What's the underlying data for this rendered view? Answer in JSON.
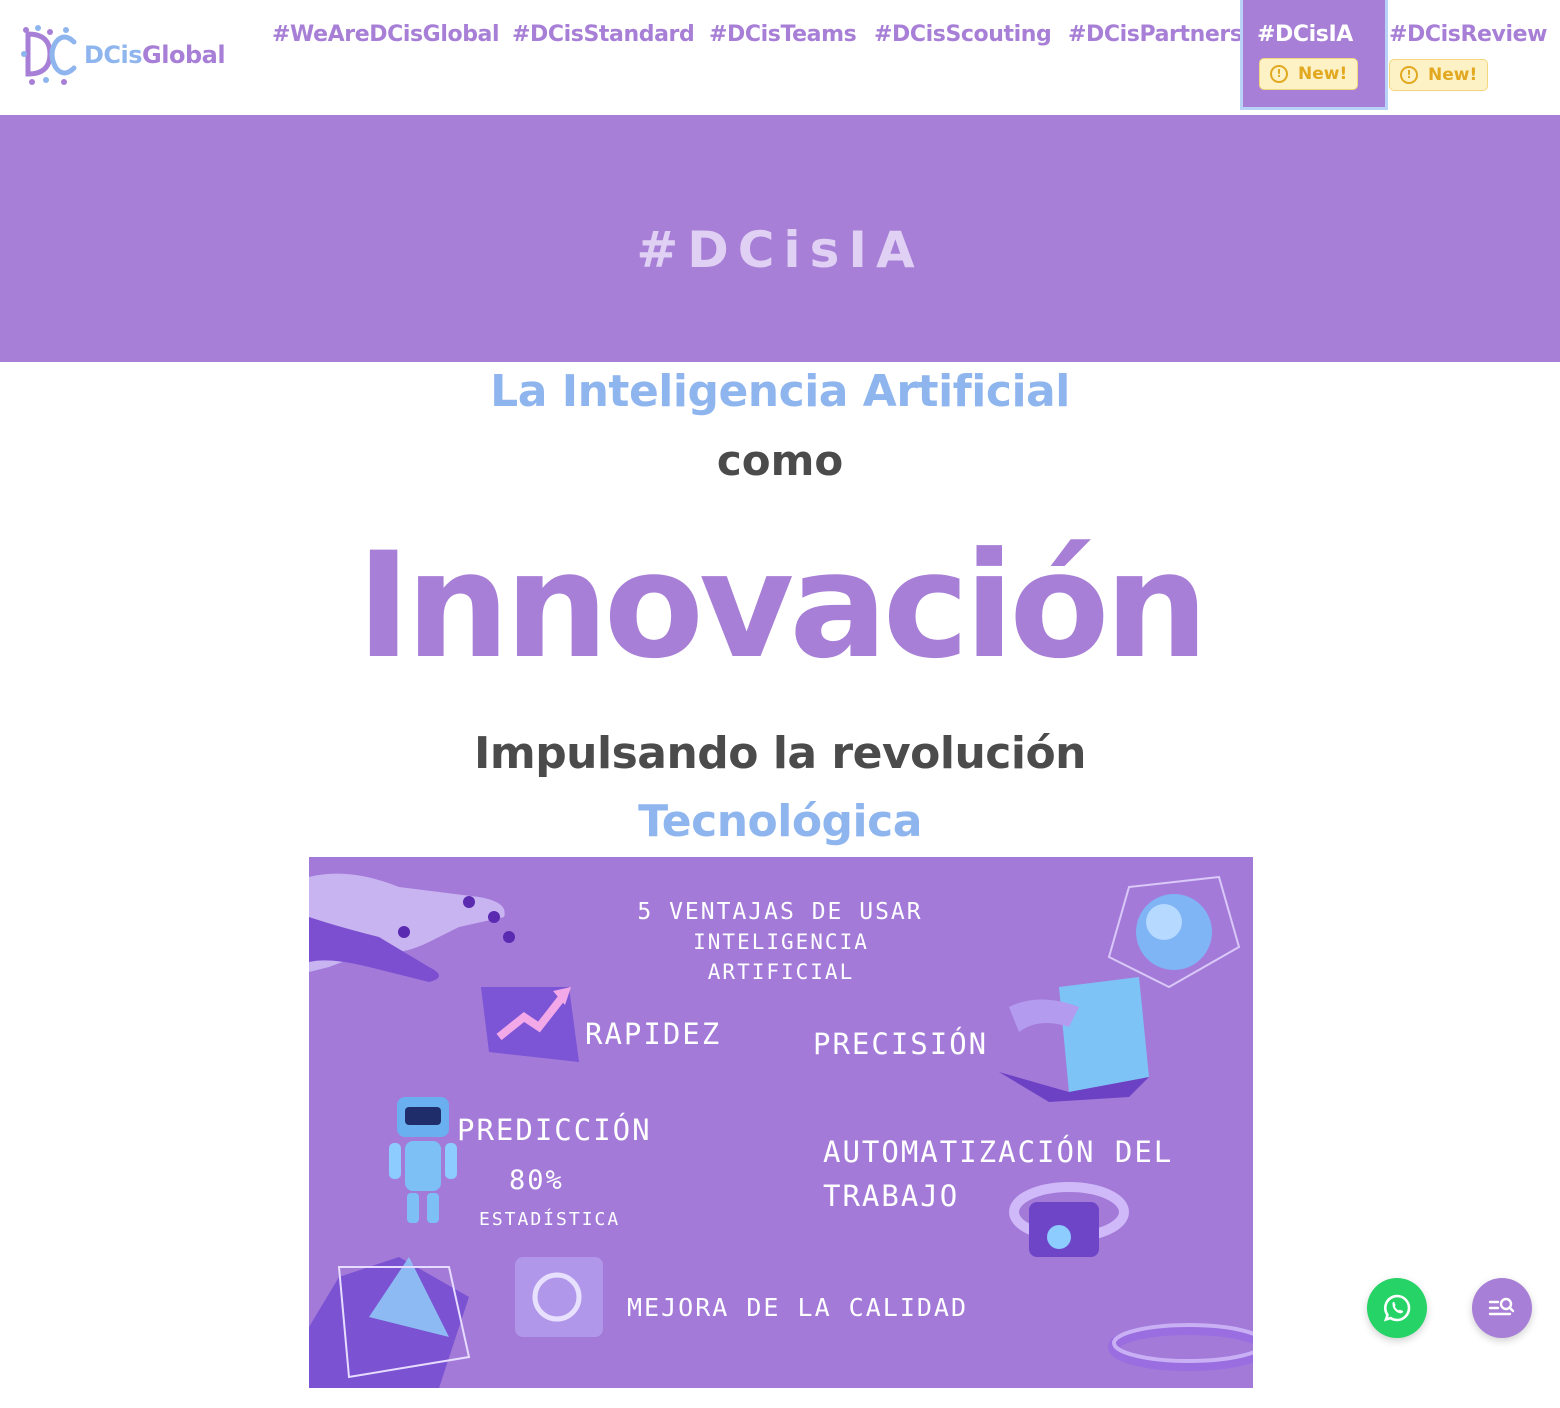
{
  "header": {
    "logo": {
      "text_part1": "DCis",
      "text_part2": "Global",
      "icon": "dc-logo-icon"
    },
    "nav": [
      {
        "label": "#WeAreDCisGlobal"
      },
      {
        "label": "#DCisStandard"
      },
      {
        "label": "#DCisTeams"
      },
      {
        "label": "#DCisScouting"
      },
      {
        "label": "#DCisPartners"
      },
      {
        "label": "#DCisIA",
        "badge": "New!",
        "active": true
      },
      {
        "label": "#DCisReview",
        "badge": "New!"
      }
    ]
  },
  "hero": {
    "title": "#DCisIA"
  },
  "headline": {
    "line1": "La Inteligencia Artificial",
    "line2": "como",
    "line3": "Innovación",
    "line4": "Impulsando la revolución",
    "line5": "Tecnológica"
  },
  "infographic": {
    "title_lines": [
      "5 VENTAJAS DE USAR",
      "INTELIGENCIA",
      "ARTIFICIAL"
    ],
    "items": {
      "rapidez": "RAPIDEZ",
      "precision": "PRECISIÓN",
      "prediccion": "PREDICCIÓN",
      "prediccion_value": "80%",
      "prediccion_sub": "ESTADÍSTICA",
      "automatizacion_1": "AUTOMATIZACIÓN DEL",
      "automatizacion_2": "TRABAJO",
      "calidad": "MEJORA DE LA CALIDAD"
    }
  },
  "floating": {
    "whatsapp_icon": "whatsapp-icon",
    "search_icon": "search-menu-icon"
  },
  "colors": {
    "brand_purple": "#a77fd6",
    "brand_blue": "#8fb5ee",
    "dark_text": "#4b4b4b",
    "badge_bg": "#fdf1c6",
    "whatsapp_green": "#25d366"
  }
}
